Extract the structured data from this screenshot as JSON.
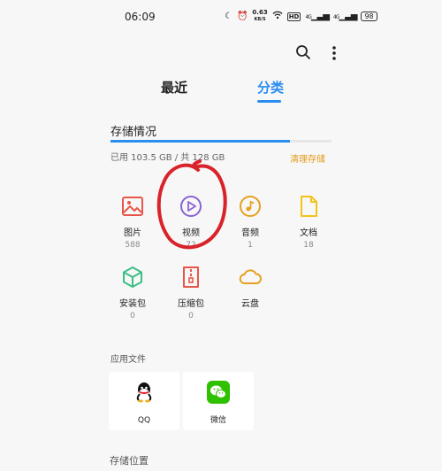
{
  "status_bar": {
    "time": "06:09",
    "net_speed_value": "0.63",
    "net_speed_unit": "KB/S",
    "hd_label": "HD",
    "signal1": "4G",
    "signal2": "4G",
    "battery": "98"
  },
  "toolbar": {
    "search_icon": "search-icon",
    "more_icon": "more-vertical-icon"
  },
  "tabs": [
    {
      "label": "最近",
      "active": false
    },
    {
      "label": "分类",
      "active": true
    }
  ],
  "storage": {
    "title": "存储情况",
    "used_text": "已用 103.5 GB / 共 128 GB",
    "used_fraction": 0.81,
    "clean_label": "清理存储"
  },
  "categories": [
    {
      "name": "图片",
      "count": "588",
      "icon": "image-icon",
      "color": "#e8564a"
    },
    {
      "name": "视频",
      "count": "72",
      "icon": "play-icon",
      "color": "#8a63d2"
    },
    {
      "name": "音频",
      "count": "1",
      "icon": "music-icon",
      "color": "#e5a020"
    },
    {
      "name": "文档",
      "count": "18",
      "icon": "document-icon",
      "color": "#f2c31a"
    },
    {
      "name": "安装包",
      "count": "0",
      "icon": "package-icon",
      "color": "#3bbf86"
    },
    {
      "name": "压缩包",
      "count": "0",
      "icon": "archive-icon",
      "color": "#e8564a"
    },
    {
      "name": "云盘",
      "count": "",
      "icon": "cloud-icon",
      "color": "#e5a020"
    }
  ],
  "apps_section": {
    "title": "应用文件",
    "apps": [
      {
        "name": "QQ",
        "icon": "qq-icon"
      },
      {
        "name": "微信",
        "icon": "wechat-icon"
      }
    ]
  },
  "location_section": {
    "title": "存储位置"
  },
  "colors": {
    "accent": "#2a8df0",
    "clean": "#e59a19",
    "annotation": "#d8232a"
  }
}
